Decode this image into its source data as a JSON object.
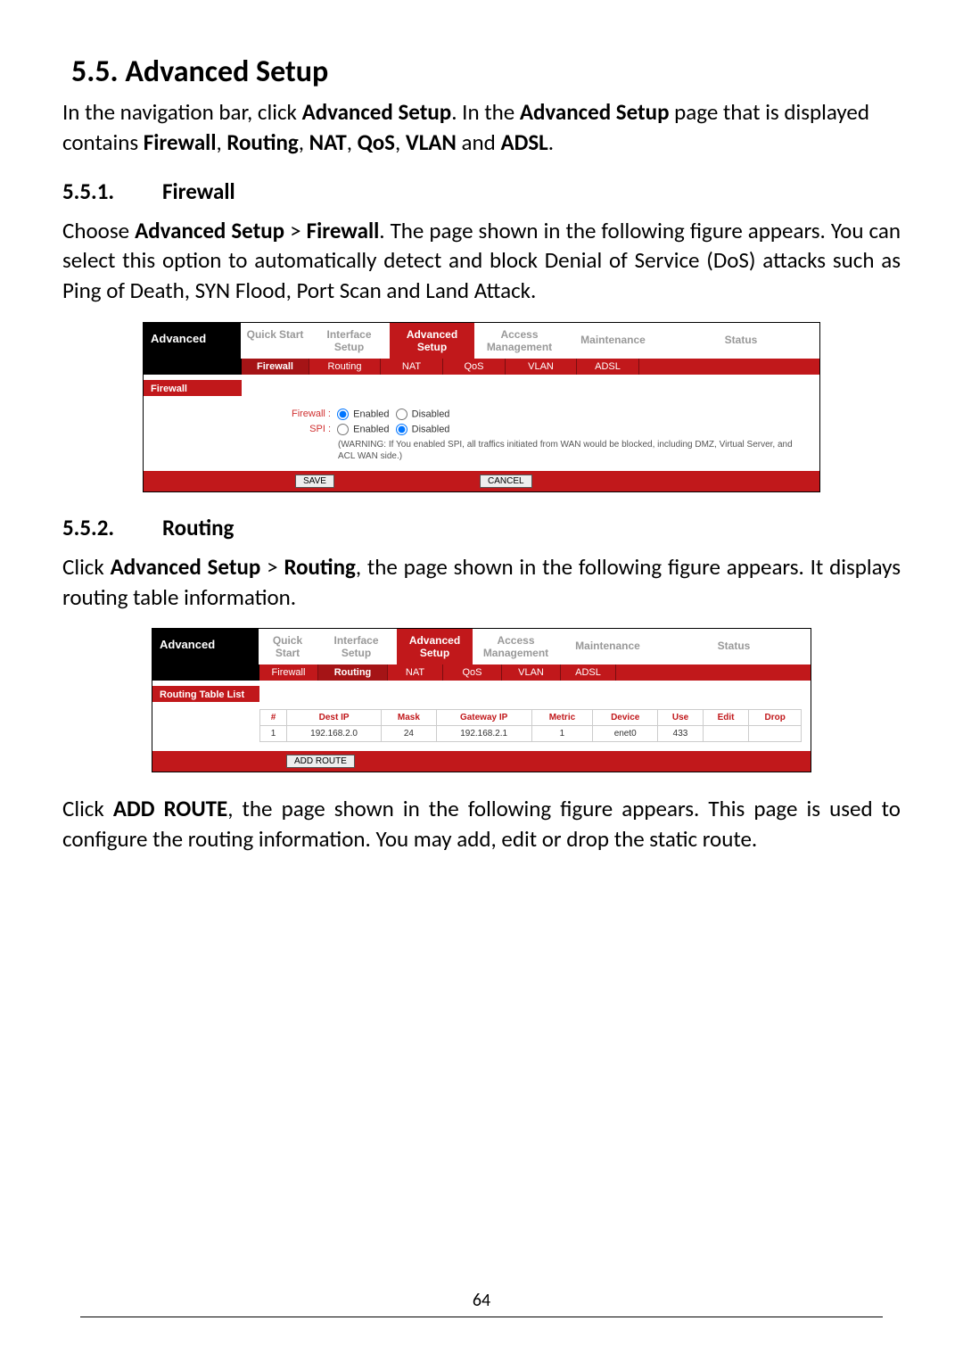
{
  "heading": "5.5. Advanced Setup",
  "intro_parts": {
    "p1": "In the navigation bar, click ",
    "b1": "Advanced Setup",
    "p2": ". In the ",
    "b2": "Advanced Setup",
    "p3": " page that is displayed contains ",
    "b3": "Firewall",
    "c1": ", ",
    "b4": "Routing",
    "c2": ", ",
    "b5": "NAT",
    "c3": ", ",
    "b6": "QoS",
    "c4": ", ",
    "b7": "VLAN",
    "c5": " and ",
    "b8": "ADSL",
    "p4": "."
  },
  "s551": {
    "num": "5.5.1.",
    "title": "Firewall"
  },
  "para551": {
    "p1": "Choose ",
    "b1": "Advanced Setup",
    "gt": " > ",
    "b2": "Firewall",
    "p2": ". The page shown in the following figure appears. You can select this option to automatically detect and block Denial of Service (DoS) attacks such as Ping of Death, SYN Flood, Port Scan and Land Attack."
  },
  "shot1": {
    "side": "Advanced",
    "nav": {
      "quick": {
        "l1": "Quick",
        "l2": "Start"
      },
      "iface": {
        "l1": "Interface",
        "l2": "Setup"
      },
      "adv": {
        "l1": "Advanced",
        "l2": "Setup"
      },
      "access": {
        "l1": "Access",
        "l2": "Management"
      },
      "maint": {
        "l1": "Maintenance"
      },
      "status": {
        "l1": "Status"
      }
    },
    "subnav": {
      "firewall": "Firewall",
      "routing": "Routing",
      "nat": "NAT",
      "qos": "QoS",
      "vlan": "VLAN",
      "adsl": "ADSL"
    },
    "subhead": "Firewall",
    "form": {
      "fw_label": "Firewall :",
      "spi_label": "SPI :",
      "opt_enabled": "Enabled",
      "opt_disabled": "Disabled",
      "warn": "(WARNING: If You enabled SPI, all traffics initiated from WAN would be blocked, including DMZ, Virtual Server, and ACL WAN side.)"
    },
    "btns": {
      "save": "SAVE",
      "cancel": "CANCEL"
    }
  },
  "s552": {
    "num": "5.5.2.",
    "title": "Routing"
  },
  "para552a": {
    "p1": "Click ",
    "b1": "Advanced Setup",
    "gt": " > ",
    "b2": "Routing",
    "p2": ", the page shown in the following figure appears. It displays routing table information."
  },
  "shot2": {
    "side": "Advanced",
    "subhead": "Routing Table List",
    "thead": {
      "n": "#",
      "dest": "Dest IP",
      "mask": "Mask",
      "gw": "Gateway IP",
      "metric": "Metric",
      "device": "Device",
      "use": "Use",
      "edit": "Edit",
      "drop": "Drop"
    },
    "row": {
      "n": "1",
      "dest": "192.168.2.0",
      "mask": "24",
      "gw": "192.168.2.1",
      "metric": "1",
      "device": "enet0",
      "use": "433",
      "edit": "",
      "drop": ""
    },
    "btn": "ADD ROUTE"
  },
  "para552b": {
    "p1": "Click ",
    "b1": "ADD ROUTE",
    "p2": ", the page shown in the following figure appears. This page is used to configure the routing information. You may add, edit or drop the static route."
  },
  "page_number": "64"
}
